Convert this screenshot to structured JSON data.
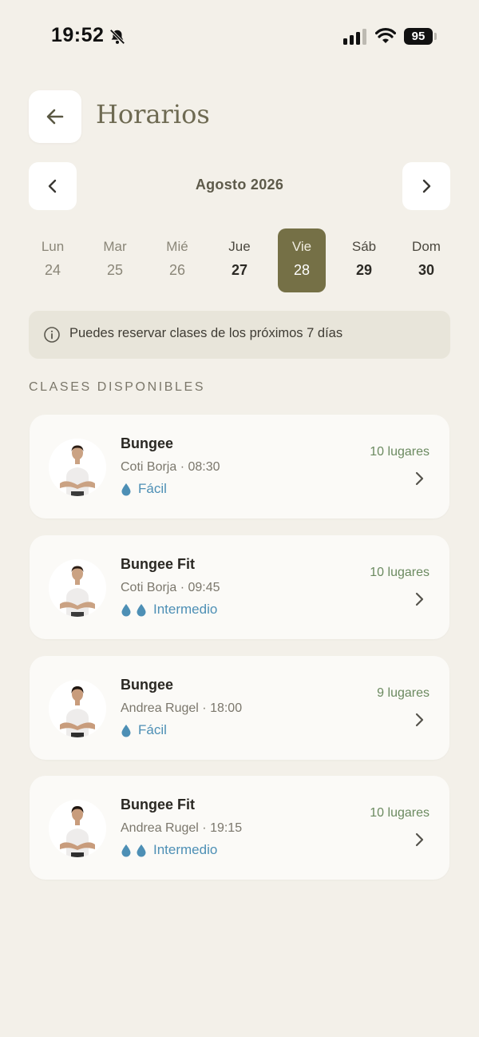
{
  "status_bar": {
    "time": "19:52",
    "battery": "95"
  },
  "header": {
    "title": "Horarios"
  },
  "calendar": {
    "month_label": "Agosto 2026",
    "days": [
      {
        "name": "Lun",
        "num": "24"
      },
      {
        "name": "Mar",
        "num": "25"
      },
      {
        "name": "Mié",
        "num": "26"
      },
      {
        "name": "Jue",
        "num": "27"
      },
      {
        "name": "Vie",
        "num": "28"
      },
      {
        "name": "Sáb",
        "num": "29"
      },
      {
        "name": "Dom",
        "num": "30"
      }
    ],
    "selected_day": "Vie 28"
  },
  "info": {
    "text": "Puedes reservar clases de los próximos 7 días"
  },
  "section": {
    "label": "CLASES DISPONIBLES"
  },
  "classes": [
    {
      "name": "Bungee",
      "meta": "Coti Borja · 08:30",
      "level": "Fácil",
      "drops": 1,
      "spots": "10 lugares"
    },
    {
      "name": "Bungee Fit",
      "meta": "Coti Borja · 09:45",
      "level": "Intermedio",
      "drops": 2,
      "spots": "10 lugares"
    },
    {
      "name": "Bungee",
      "meta": "Andrea Rugel · 18:00",
      "level": "Fácil",
      "drops": 1,
      "spots": "9 lugares"
    },
    {
      "name": "Bungee Fit",
      "meta": "Andrea Rugel · 19:15",
      "level": "Intermedio",
      "drops": 2,
      "spots": "10 lugares"
    }
  ],
  "colors": {
    "background": "#f3f0e9",
    "accent": "#757046",
    "level_blue": "#4d8fb5",
    "spots_green": "#6b8a60"
  }
}
